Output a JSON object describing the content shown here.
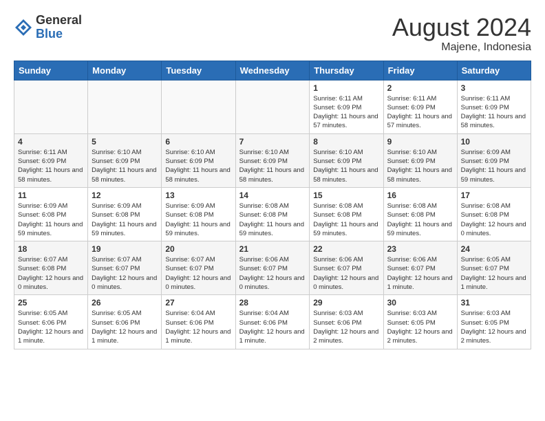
{
  "header": {
    "logo": {
      "general": "General",
      "blue": "Blue"
    },
    "title": "August 2024",
    "location": "Majene, Indonesia"
  },
  "calendar": {
    "days_of_week": [
      "Sunday",
      "Monday",
      "Tuesday",
      "Wednesday",
      "Thursday",
      "Friday",
      "Saturday"
    ],
    "weeks": [
      [
        {
          "day": "",
          "info": ""
        },
        {
          "day": "",
          "info": ""
        },
        {
          "day": "",
          "info": ""
        },
        {
          "day": "",
          "info": ""
        },
        {
          "day": "1",
          "info": "Sunrise: 6:11 AM\nSunset: 6:09 PM\nDaylight: 11 hours\nand 57 minutes."
        },
        {
          "day": "2",
          "info": "Sunrise: 6:11 AM\nSunset: 6:09 PM\nDaylight: 11 hours\nand 57 minutes."
        },
        {
          "day": "3",
          "info": "Sunrise: 6:11 AM\nSunset: 6:09 PM\nDaylight: 11 hours\nand 58 minutes."
        }
      ],
      [
        {
          "day": "4",
          "info": "Sunrise: 6:11 AM\nSunset: 6:09 PM\nDaylight: 11 hours\nand 58 minutes."
        },
        {
          "day": "5",
          "info": "Sunrise: 6:10 AM\nSunset: 6:09 PM\nDaylight: 11 hours\nand 58 minutes."
        },
        {
          "day": "6",
          "info": "Sunrise: 6:10 AM\nSunset: 6:09 PM\nDaylight: 11 hours\nand 58 minutes."
        },
        {
          "day": "7",
          "info": "Sunrise: 6:10 AM\nSunset: 6:09 PM\nDaylight: 11 hours\nand 58 minutes."
        },
        {
          "day": "8",
          "info": "Sunrise: 6:10 AM\nSunset: 6:09 PM\nDaylight: 11 hours\nand 58 minutes."
        },
        {
          "day": "9",
          "info": "Sunrise: 6:10 AM\nSunset: 6:09 PM\nDaylight: 11 hours\nand 58 minutes."
        },
        {
          "day": "10",
          "info": "Sunrise: 6:09 AM\nSunset: 6:09 PM\nDaylight: 11 hours\nand 59 minutes."
        }
      ],
      [
        {
          "day": "11",
          "info": "Sunrise: 6:09 AM\nSunset: 6:08 PM\nDaylight: 11 hours\nand 59 minutes."
        },
        {
          "day": "12",
          "info": "Sunrise: 6:09 AM\nSunset: 6:08 PM\nDaylight: 11 hours\nand 59 minutes."
        },
        {
          "day": "13",
          "info": "Sunrise: 6:09 AM\nSunset: 6:08 PM\nDaylight: 11 hours\nand 59 minutes."
        },
        {
          "day": "14",
          "info": "Sunrise: 6:08 AM\nSunset: 6:08 PM\nDaylight: 11 hours\nand 59 minutes."
        },
        {
          "day": "15",
          "info": "Sunrise: 6:08 AM\nSunset: 6:08 PM\nDaylight: 11 hours\nand 59 minutes."
        },
        {
          "day": "16",
          "info": "Sunrise: 6:08 AM\nSunset: 6:08 PM\nDaylight: 11 hours\nand 59 minutes."
        },
        {
          "day": "17",
          "info": "Sunrise: 6:08 AM\nSunset: 6:08 PM\nDaylight: 12 hours\nand 0 minutes."
        }
      ],
      [
        {
          "day": "18",
          "info": "Sunrise: 6:07 AM\nSunset: 6:08 PM\nDaylight: 12 hours\nand 0 minutes."
        },
        {
          "day": "19",
          "info": "Sunrise: 6:07 AM\nSunset: 6:07 PM\nDaylight: 12 hours\nand 0 minutes."
        },
        {
          "day": "20",
          "info": "Sunrise: 6:07 AM\nSunset: 6:07 PM\nDaylight: 12 hours\nand 0 minutes."
        },
        {
          "day": "21",
          "info": "Sunrise: 6:06 AM\nSunset: 6:07 PM\nDaylight: 12 hours\nand 0 minutes."
        },
        {
          "day": "22",
          "info": "Sunrise: 6:06 AM\nSunset: 6:07 PM\nDaylight: 12 hours\nand 0 minutes."
        },
        {
          "day": "23",
          "info": "Sunrise: 6:06 AM\nSunset: 6:07 PM\nDaylight: 12 hours\nand 1 minute."
        },
        {
          "day": "24",
          "info": "Sunrise: 6:05 AM\nSunset: 6:07 PM\nDaylight: 12 hours\nand 1 minute."
        }
      ],
      [
        {
          "day": "25",
          "info": "Sunrise: 6:05 AM\nSunset: 6:06 PM\nDaylight: 12 hours\nand 1 minute."
        },
        {
          "day": "26",
          "info": "Sunrise: 6:05 AM\nSunset: 6:06 PM\nDaylight: 12 hours\nand 1 minute."
        },
        {
          "day": "27",
          "info": "Sunrise: 6:04 AM\nSunset: 6:06 PM\nDaylight: 12 hours\nand 1 minute."
        },
        {
          "day": "28",
          "info": "Sunrise: 6:04 AM\nSunset: 6:06 PM\nDaylight: 12 hours\nand 1 minute."
        },
        {
          "day": "29",
          "info": "Sunrise: 6:03 AM\nSunset: 6:06 PM\nDaylight: 12 hours\nand 2 minutes."
        },
        {
          "day": "30",
          "info": "Sunrise: 6:03 AM\nSunset: 6:05 PM\nDaylight: 12 hours\nand 2 minutes."
        },
        {
          "day": "31",
          "info": "Sunrise: 6:03 AM\nSunset: 6:05 PM\nDaylight: 12 hours\nand 2 minutes."
        }
      ]
    ]
  }
}
